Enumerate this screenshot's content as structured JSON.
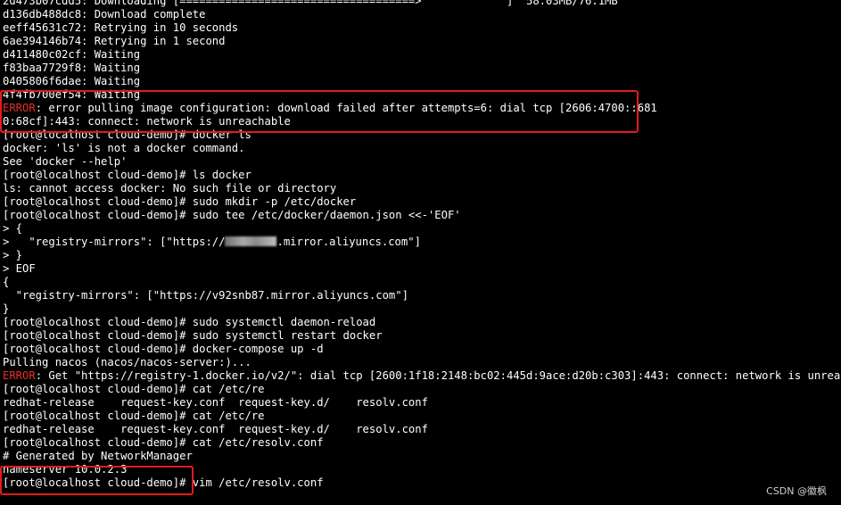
{
  "terminal": {
    "lines": [
      {
        "text": "2d473b07cdd5: Downloading [====================================>             ]  58.03MB/76.1MB"
      },
      {
        "text": "d136db488dc8: Download complete"
      },
      {
        "text": "eeff45631c72: Retrying in 10 seconds"
      },
      {
        "text": "6ae394146b74: Retrying in 1 second"
      },
      {
        "text": "d411480c02cf: Waiting"
      },
      {
        "text": "f83baa7729f8: Waiting"
      },
      {
        "text": "0405806f6dae: Waiting"
      },
      {
        "text": "4f4fb700ef54: Waiting"
      },
      {
        "prefix": "ERROR",
        "text": ": error pulling image configuration: download failed after attempts=6: dial tcp [2606:4700::681"
      },
      {
        "text": "0:68cf]:443: connect: network is unreachable"
      },
      {
        "text": "[root@localhost cloud-demo]# docker ls"
      },
      {
        "text": "docker: 'ls' is not a docker command."
      },
      {
        "text": "See 'docker --help'"
      },
      {
        "text": "[root@localhost cloud-demo]# ls docker"
      },
      {
        "text": "ls: cannot access docker: No such file or directory"
      },
      {
        "text": "[root@localhost cloud-demo]# sudo mkdir -p /etc/docker"
      },
      {
        "text": "[root@localhost cloud-demo]# sudo tee /etc/docker/daemon.json <<-'EOF'"
      },
      {
        "text": "> {"
      },
      {
        "text": ">   \"registry-mirrors\": [\"https://",
        "redacted": true,
        "after": ".mirror.aliyuncs.com\"]"
      },
      {
        "text": "> }"
      },
      {
        "text": "> EOF"
      },
      {
        "text": "{"
      },
      {
        "text": "  \"registry-mirrors\": [\"https://v92snb87.mirror.aliyuncs.com\"]"
      },
      {
        "text": "}"
      },
      {
        "text": "[root@localhost cloud-demo]# sudo systemctl daemon-reload"
      },
      {
        "text": "[root@localhost cloud-demo]# sudo systemctl restart docker"
      },
      {
        "text": "[root@localhost cloud-demo]# docker-compose up -d"
      },
      {
        "text": "Pulling nacos (nacos/nacos-server:)..."
      },
      {
        "prefix": "ERROR",
        "text": ": Get \"https://registry-1.docker.io/v2/\": dial tcp [2600:1f18:2148:bc02:445d:9ace:d20b:c303]:443: connect: network is unreachable"
      },
      {
        "text": "[root@localhost cloud-demo]# cat /etc/re"
      },
      {
        "text": "redhat-release    request-key.conf  request-key.d/    resolv.conf"
      },
      {
        "text": "[root@localhost cloud-demo]# cat /etc/re"
      },
      {
        "text": "redhat-release    request-key.conf  request-key.d/    resolv.conf"
      },
      {
        "text": "[root@localhost cloud-demo]# cat /etc/resolv.conf"
      },
      {
        "text": "# Generated by NetworkManager"
      },
      {
        "text": "nameserver 10.0.2.3"
      },
      {
        "text": "[root@localhost cloud-demo]# vim /etc/resolv.conf"
      }
    ],
    "colors": {
      "background": "#000000",
      "foreground": "#ffffff",
      "error": "#e8302b",
      "highlight_box": "#e51b1b"
    }
  },
  "watermark": "CSDN @徽枫"
}
